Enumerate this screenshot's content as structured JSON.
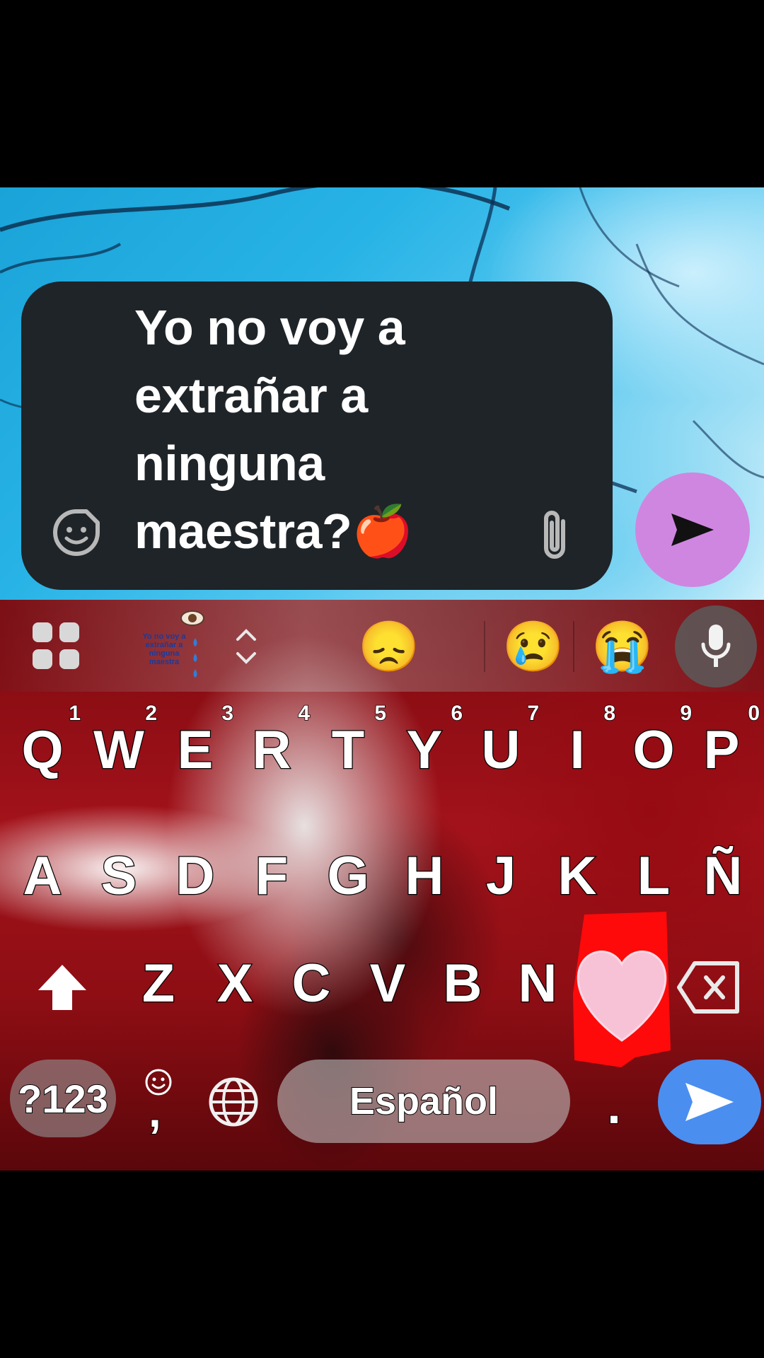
{
  "compose": {
    "message_text": "Yo no voy a extrañar a ninguna maestra?🍎",
    "send_icon": "send-icon",
    "sticker_icon": "sticker-icon",
    "attach_icon": "paperclip-icon"
  },
  "keyboard": {
    "suggestions": {
      "sticker_text": "Yo no voy a extrañar a ninguna maestra",
      "emojis": [
        "😞",
        "😢",
        "😭"
      ]
    },
    "row1": [
      {
        "label": "Q",
        "hint": "1"
      },
      {
        "label": "W",
        "hint": "2"
      },
      {
        "label": "E",
        "hint": "3"
      },
      {
        "label": "R",
        "hint": "4"
      },
      {
        "label": "T",
        "hint": "5"
      },
      {
        "label": "Y",
        "hint": "6"
      },
      {
        "label": "U",
        "hint": "7"
      },
      {
        "label": "I",
        "hint": "8"
      },
      {
        "label": "O",
        "hint": "9"
      },
      {
        "label": "P",
        "hint": "0"
      }
    ],
    "row2": [
      "A",
      "S",
      "D",
      "F",
      "G",
      "H",
      "J",
      "K",
      "L",
      "Ñ"
    ],
    "row3": [
      "Z",
      "X",
      "C",
      "V",
      "B",
      "N"
    ],
    "symbols_label": "?123",
    "comma_label": ",",
    "space_label": "Español",
    "period_label": ".",
    "colors": {
      "enter_button": "#4a8ef0",
      "send_fab": "#cf86e0",
      "compose_bg": "#1f2428"
    }
  }
}
